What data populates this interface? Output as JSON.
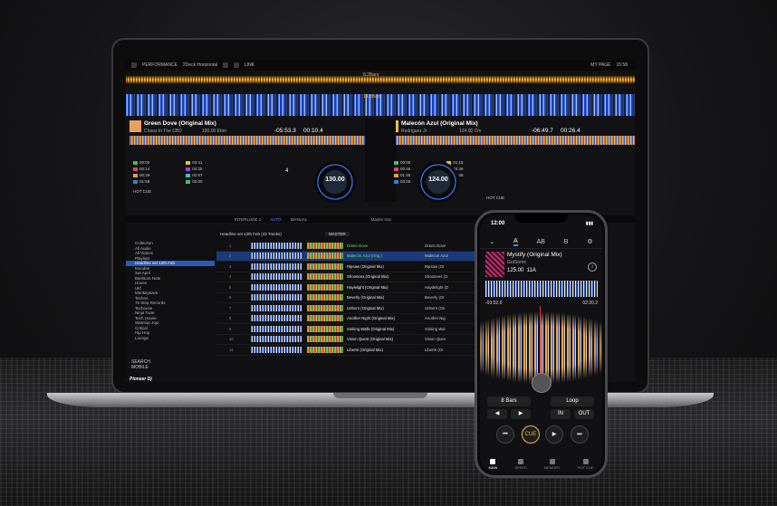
{
  "laptop": {
    "topbar": {
      "mode": "PERFORMANCE",
      "layout": "2Deck Horizontal",
      "link": "LINK",
      "my_page": "MY PAGE",
      "clock": "15:58"
    },
    "bars_top": "8.2Bars",
    "bars_bottom": "14.3Bars",
    "deck1": {
      "title": "Green Dove (Original Mix)",
      "artist": "Chaos In The CBD",
      "bpm_key": "130.00 Ebm",
      "time_remain": "-05:53.3",
      "time_elapsed": "00:10.4",
      "deck_no": "4",
      "jog_bpm": "130.00",
      "jog_sub": "0.00",
      "cues": [
        "00:00",
        "00:14",
        "00:29",
        "01:58",
        "03:41",
        "04:25",
        "02:57",
        "03:00"
      ],
      "hot_cue": "HOT CUE"
    },
    "deck2": {
      "title": "Malecón Azul (Original Mix)",
      "artist": "Rodriguez Jr",
      "bpm_key": "124.00 Cm",
      "time_remain": "-06:49.7",
      "time_elapsed": "00:26.4",
      "deck_no": "4",
      "jog_bpm": "124.00",
      "jog_sub": "0.00",
      "cues": [
        "00:00",
        "00:46",
        "01:46",
        "03:00",
        "01:15",
        "02:46",
        "03:48",
        ""
      ],
      "hot_cue": "HOT CUE"
    },
    "fx": {
      "auto": "AUTO",
      "manual": "MANUAL",
      "interlude": "INTERLUDE 1",
      "master_out": "Master Out",
      "black_out": "BLACK OUT"
    },
    "browser": {
      "tree": [
        "Collection",
        "All Audio",
        "All Videos",
        "Playlists",
        "Headline set 12th Feb",
        "Moodee",
        "Set April",
        "Bar/Bom Note",
        "House",
        "Ukf",
        "Monkeytown",
        "Techno",
        "76 Step Records",
        "Techouse",
        "Ninja Tune",
        "Tech House",
        "Warmup Jojo",
        "Critical",
        "Hip Hop",
        "Lounge"
      ],
      "list_title": "Headline set 12th Feb (43 Tracks)",
      "search": "SEARCH",
      "mobile": "MOBILE",
      "master": "MASTER",
      "tracks": [
        {
          "n": "1",
          "title": "Green Dove",
          "title2": "Chaos In The CBD",
          "tt": "Green Dove"
        },
        {
          "n": "2",
          "title": "Malecón Azul (Orig.)",
          "title2": "Rodriguez Jr",
          "tt": "Malecon Azul"
        },
        {
          "n": "3",
          "title": "Ripsaw (Original Mix)",
          "title2": "Ki Creighton",
          "tt": "Ripsaw (Or"
        },
        {
          "n": "4",
          "title": "Shoonees (Original Mix)",
          "title2": "Beatrul",
          "tt": "Shoonees (O"
        },
        {
          "n": "5",
          "title": "Haylelight (Original Mix)",
          "title2": "MYHT",
          "tt": "Haydelight (O"
        },
        {
          "n": "6",
          "title": "Beverly (Original Mix)",
          "title2": "Sulan",
          "tt": "Beverly (Or"
        },
        {
          "n": "7",
          "title": "Unborn (Original Mix)",
          "title2": "Timothy Carson",
          "tt": "Unborn (Ori"
        },
        {
          "n": "8",
          "title": "Another Night (Original Mix)",
          "title2": "A.R.M.G.",
          "tt": "Another Nig"
        },
        {
          "n": "9",
          "title": "Sinking Walls (Original Mix)",
          "title2": "Sulan",
          "tt": "Sinking Wal"
        },
        {
          "n": "10",
          "title": "Vision Quest (Original Mix)",
          "title2": "Grandale",
          "tt": "Vision Ques"
        },
        {
          "n": "11",
          "title": "Liberté (Original Mix)",
          "title2": "",
          "tt": "Liberté (Or"
        }
      ]
    },
    "brand": "Pioneer Dj"
  },
  "phone": {
    "status_time": "12:00",
    "tabs": [
      "A",
      "AB",
      "B"
    ],
    "track": "Mystify (Original Mix)",
    "artist": "GotSome",
    "bpm": "125.00",
    "key": "11A",
    "time_left": "-03:52.6",
    "time_right": "02:20.2",
    "beat_label": "8 Bars",
    "loop_label": "Loop",
    "in": "IN",
    "out": "OUT",
    "cue": "CUE",
    "nav": [
      "MAIN",
      "SPEED",
      "MEMORY",
      "HOT CUE"
    ]
  },
  "colors": {
    "accent_blue": "#3b6ef0",
    "wave_orange": "#e8941a",
    "highlight_row": "#1b3a78",
    "cue_red": "#e53030"
  }
}
